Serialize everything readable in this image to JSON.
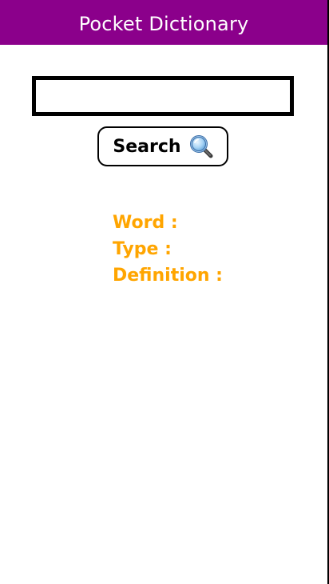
{
  "app": {
    "title": "Pocket Dictionary"
  },
  "search": {
    "value": "",
    "placeholder": "",
    "button_label": "Search",
    "button_icon": "search-icon"
  },
  "result": {
    "word_label": "Word :",
    "type_label": "Type :",
    "definition_label": "Definition :"
  },
  "colors": {
    "header_bg": "#8b008b",
    "header_text": "#ffffff",
    "result_text": "#ffa500",
    "border": "#000000"
  }
}
